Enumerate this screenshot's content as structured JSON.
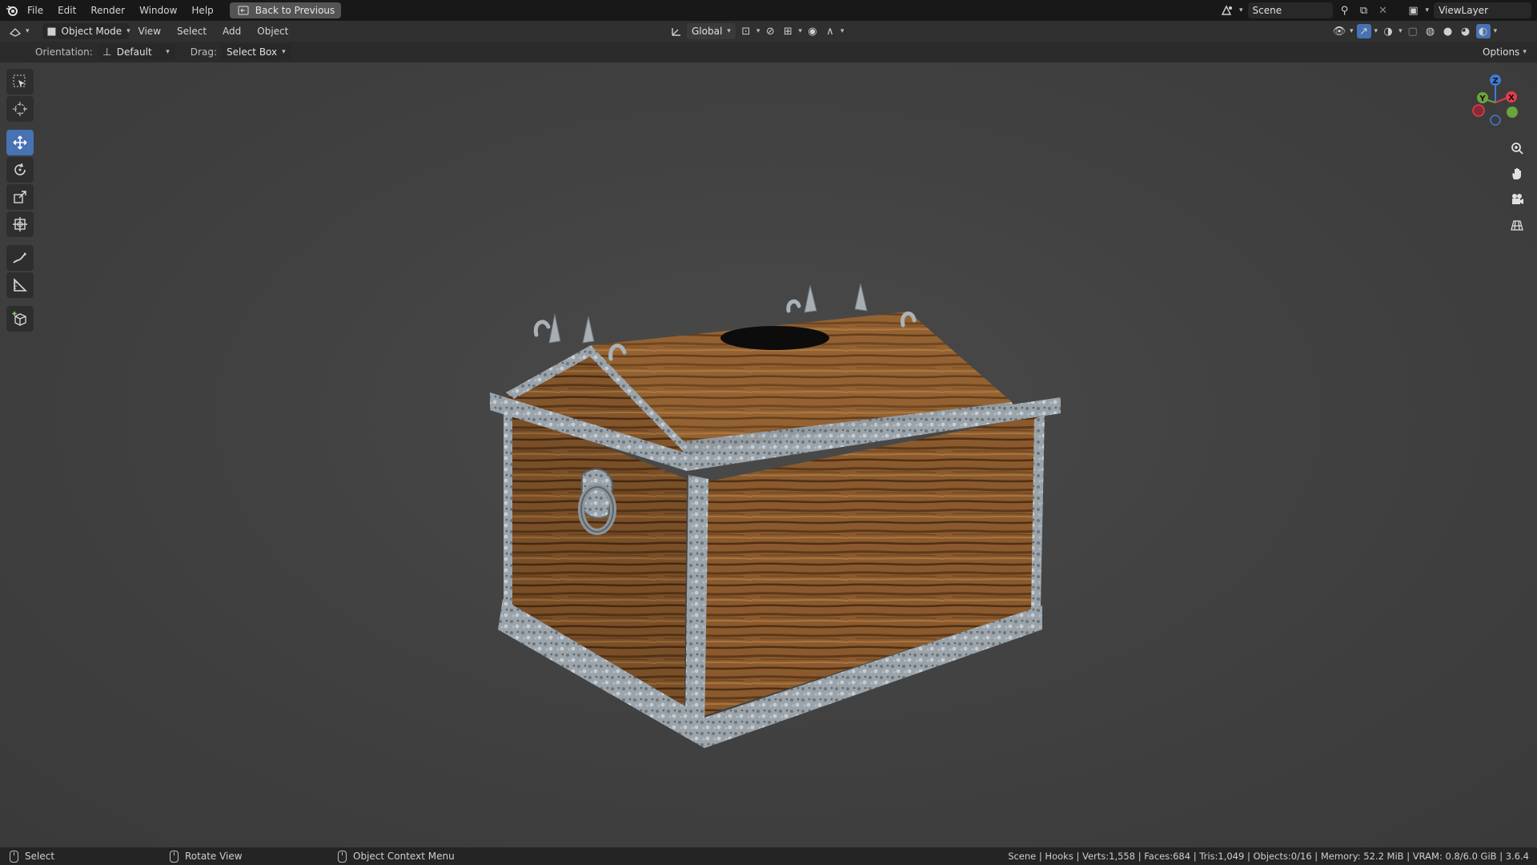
{
  "app": {
    "menus": [
      "File",
      "Edit",
      "Render",
      "Window",
      "Help"
    ],
    "back_button": "Back to Previous",
    "scene_name": "Scene",
    "view_layer": "ViewLayer"
  },
  "header": {
    "mode": "Object Mode",
    "menus": [
      "View",
      "Select",
      "Add",
      "Object"
    ],
    "transform_orientation": "Global"
  },
  "tool_settings": {
    "orientation_label": "Orientation:",
    "orientation_value": "Default",
    "drag_label": "Drag:",
    "drag_value": "Select Box",
    "options_label": "Options"
  },
  "toolbar": {
    "tools": [
      "select-box",
      "cursor",
      "move",
      "rotate",
      "scale",
      "transform",
      "annotate",
      "measure",
      "add-cube"
    ],
    "active": "move"
  },
  "gizmo": {
    "axes": [
      "Z",
      "Y",
      "X"
    ]
  },
  "status": {
    "select": "Select",
    "rotate_view": "Rotate View",
    "context_menu": "Object Context Menu",
    "stats": "Scene | Hooks | Verts:1,558 | Faces:684 | Tris:1,049 | Objects:0/16 | Memory: 52.2 MiB | VRAM: 0.8/6.0 GiB | 3.6.4"
  },
  "colors": {
    "accent": "#4772b3",
    "axis_x": "#e63c4b",
    "axis_y": "#6ba43a",
    "axis_z": "#3f7bd6",
    "wood": "#8a5a2e",
    "metal": "#9aa3ab"
  }
}
